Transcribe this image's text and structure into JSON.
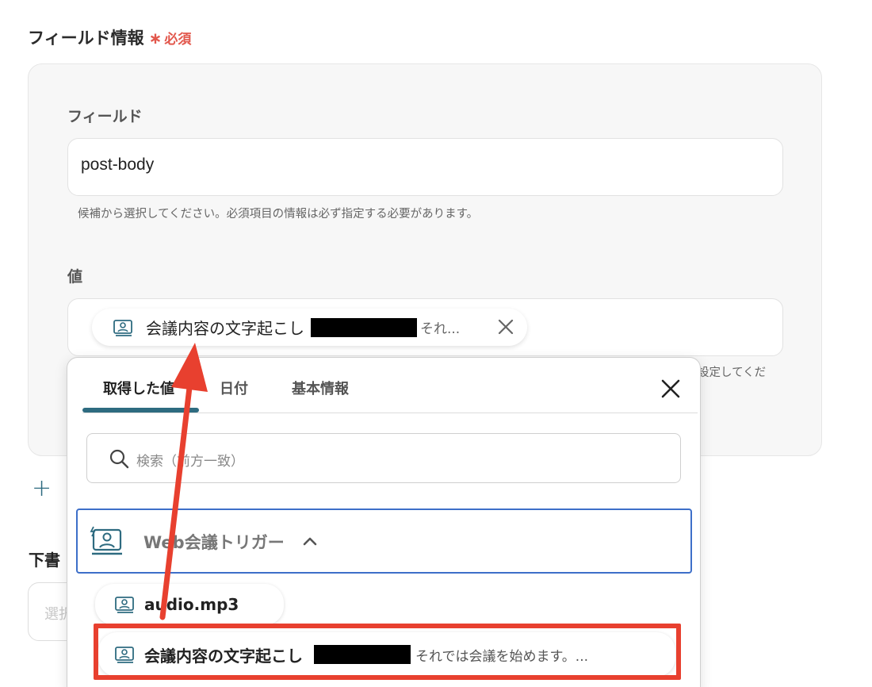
{
  "section": {
    "title": "フィールド情報",
    "required": "必須"
  },
  "field": {
    "label": "フィールド",
    "value": "post-body",
    "hint": "候補から選択してください。必須項目の情報は必ず指定する必要があります。"
  },
  "value_field": {
    "label": "値",
    "chip": {
      "label": "会議内容の文字起こし",
      "preview": "それ..."
    },
    "hint_fragment": "設定してくだ"
  },
  "draft": {
    "label": "下書",
    "placeholder": "選択"
  },
  "picker": {
    "tabs": [
      "取得した値",
      "日付",
      "基本情報"
    ],
    "active_tab": "取得した値",
    "search_placeholder": "検索（前方一致）",
    "group": {
      "label": "Web会議トリガー",
      "expanded": true
    },
    "items": [
      {
        "label": "audio.mp3",
        "preview": ""
      },
      {
        "label": "会議内容の文字起こし",
        "preview": "それでは会議を始めます。..."
      }
    ]
  },
  "colors": {
    "accent": "#2e6b80",
    "required": "#e2574c",
    "annotation": "#e8402f",
    "group_border": "#3d6fc9"
  }
}
